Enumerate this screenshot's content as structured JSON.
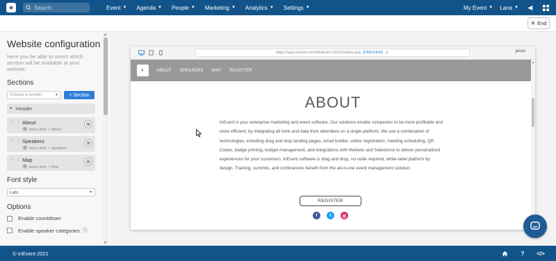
{
  "colors": {
    "nav_bg": "#12548a",
    "accent": "#2f7ed8",
    "site_nav_bg": "#999999"
  },
  "topnav": {
    "search_placeholder": "Search",
    "menu": [
      {
        "label": "Event"
      },
      {
        "label": "Agenda"
      },
      {
        "label": "People"
      },
      {
        "label": "Marketing"
      },
      {
        "label": "Analytics"
      },
      {
        "label": "Settings"
      }
    ],
    "event_selector": "My Event",
    "user": "Lana",
    "icons": [
      "megaphone-icon",
      "grid-icon"
    ]
  },
  "subbar": {
    "end_label": "End"
  },
  "left_panel": {
    "title": "Website configuration",
    "description": "Here you be able to select which section will be available at your website.",
    "sections_heading": "Sections",
    "choose_placeholder": "Choose a section",
    "add_section_label": "+ Section",
    "header_item": "Header",
    "sections": [
      {
        "name": "About",
        "visibility": "menu item",
        "target": "About"
      },
      {
        "name": "Speakers",
        "visibility": "menu item",
        "target": "Speakers"
      },
      {
        "name": "Map",
        "visibility": "menu item",
        "target": "Map"
      }
    ],
    "font_heading": "Font style",
    "font_value": "Lato",
    "options_heading": "Options",
    "options": [
      {
        "label": "Enable countdown"
      },
      {
        "label": "Enable speaker categories"
      }
    ]
  },
  "preview": {
    "url": "https://app.inevent.com/MyEvent-2021/hotsite.php",
    "preview_tag": "[PREVIEW]",
    "user": "janus",
    "site_nav": [
      "ABOUT",
      "SPEAKERS",
      "MAP",
      "REGISTER"
    ],
    "about_title": "ABOUT",
    "about_text": "InEvent is your enterprise marketing and event software. Our solutions enable companies to be more profitable and more efficient, by integrating all tools and data from attendees on a single platform. We use a combination of technologies, including drag and drop landing pages, email builder, online registration, meeting scheduling, QR Codes, badge printing, budget management, and integrations with Marketo and Salesforce to deliver personalized experiences for your customers. InEvent software is drag and drop, no code required, white-label platform by design. Training, summits, and conferences benefit from the all-in-one event management solution.",
    "register_label": "REGISTER",
    "socials": [
      {
        "name": "facebook",
        "glyph": "f",
        "color": "#3b5998"
      },
      {
        "name": "twitter",
        "glyph": "t",
        "color": "#1da1f2"
      },
      {
        "name": "instagram",
        "glyph": "◎",
        "color": "#d6336c"
      }
    ]
  },
  "footer": {
    "copyright": "© InEvent 2021"
  }
}
